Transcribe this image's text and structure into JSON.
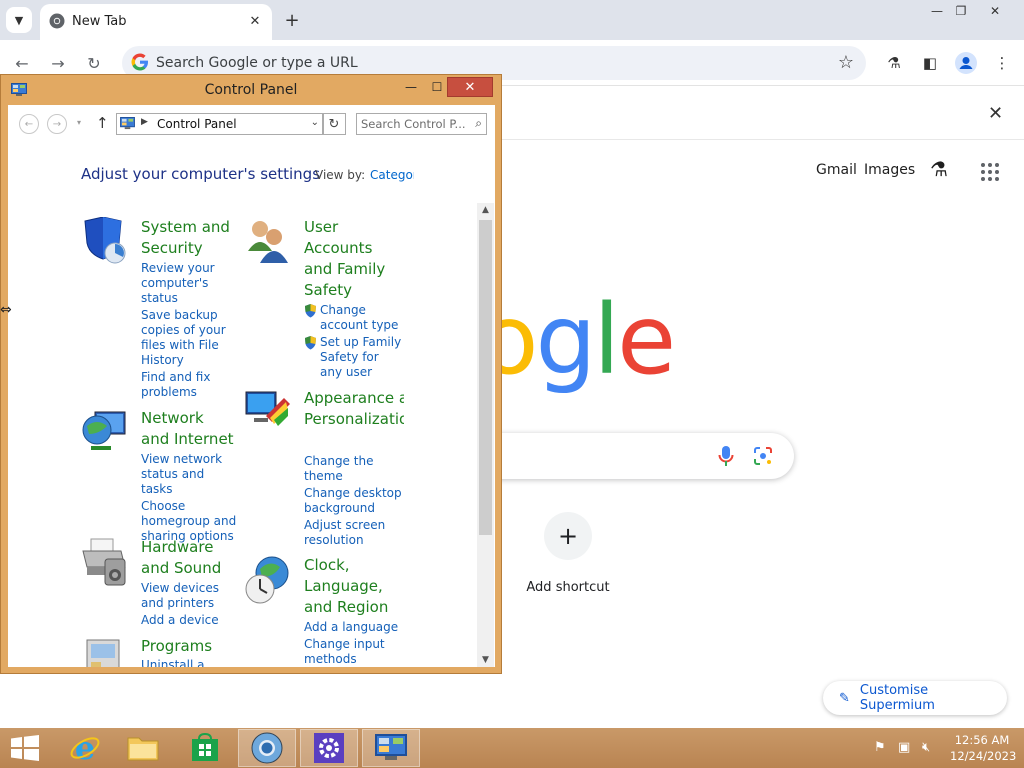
{
  "browser": {
    "tab_title": "New Tab",
    "omnibox_placeholder": "Search Google or type a URL",
    "ntp_links": [
      "Gmail",
      "Images"
    ],
    "logo_text": "oogle",
    "shortcut_label": "Add shortcut",
    "customise_label": "Customise Supermium"
  },
  "control_panel": {
    "window_title": "Control Panel",
    "breadcrumb": "Control Panel",
    "search_placeholder": "Search Control P...",
    "heading": "Adjust your computer's settings",
    "view_by_label": "View by:",
    "view_by_value": "Category",
    "categories": [
      {
        "title": "System and Security",
        "links": [
          "Review your computer's status",
          "Save backup copies of your files with File History",
          "Find and fix problems"
        ]
      },
      {
        "title": "Network and Internet",
        "links": [
          "View network status and tasks",
          "Choose homegroup and sharing options"
        ]
      },
      {
        "title": "Hardware and Sound",
        "links": [
          "View devices and printers",
          "Add a device"
        ]
      },
      {
        "title": "Programs",
        "links": [
          "Uninstall a program"
        ]
      },
      {
        "title": "User Accounts and Family Safety",
        "links": [
          "Change account type",
          "Set up Family Safety for any user"
        ]
      },
      {
        "title": "Appearance and Personalization",
        "links": [
          "Change the theme",
          "Change desktop background",
          "Adjust screen resolution"
        ]
      },
      {
        "title": "Clock, Language, and Region",
        "links": [
          "Add a language",
          "Change input methods"
        ]
      }
    ]
  },
  "taskbar": {
    "time": "12:56 AM",
    "date": "12/24/2023"
  }
}
